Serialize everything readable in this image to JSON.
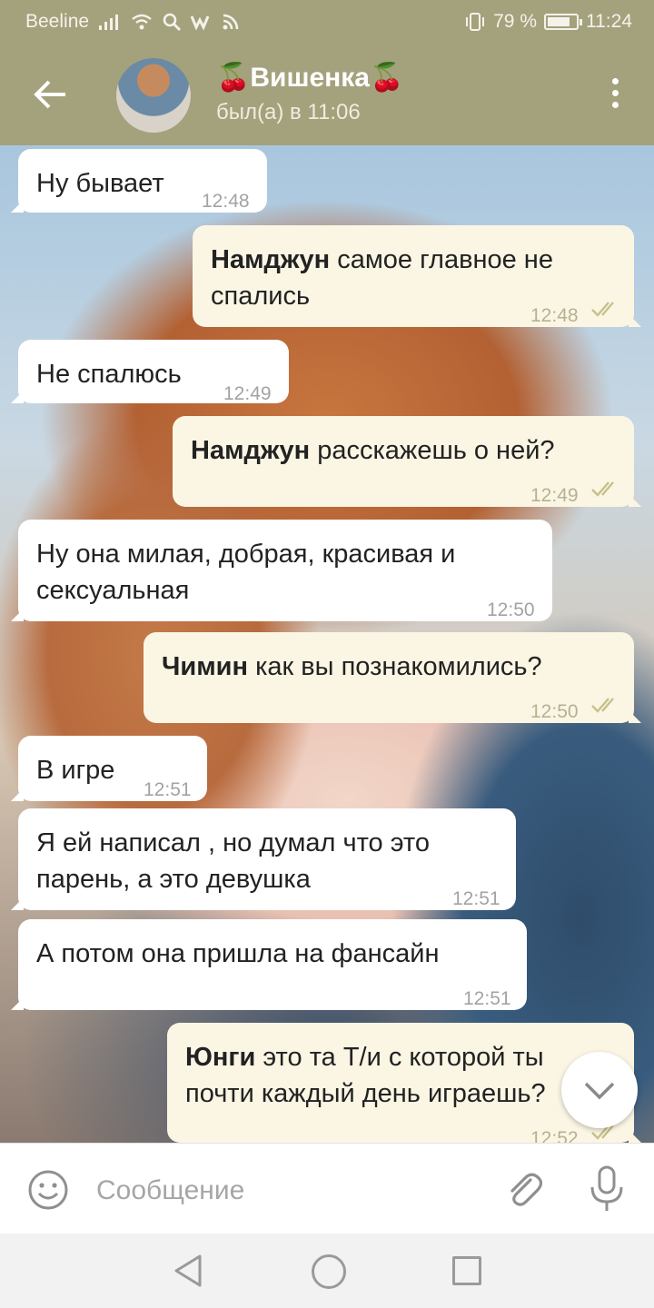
{
  "status_bar": {
    "carrier": "Beeline",
    "battery": "79 %",
    "battery_level": 0.79,
    "time": "11:24",
    "icons": [
      "signal-icon",
      "wifi-icon",
      "search-icon",
      "vk-icon",
      "rss-icon",
      "vibrate-icon",
      "battery-icon"
    ]
  },
  "header": {
    "contact_name": "🍒Вишенка🍒",
    "status": "был(а) в 11:06",
    "icons": [
      "back-arrow-icon",
      "avatar",
      "more-vert-icon"
    ]
  },
  "messages": [
    {
      "dir": "in",
      "text": "Ну бывает",
      "time": "12:48"
    },
    {
      "dir": "out",
      "name": "Намджун",
      "text": "самое главное не спались",
      "line1": "самое главное не",
      "line2": "спались",
      "time": "12:48",
      "read": true
    },
    {
      "dir": "in",
      "text": "Не спалюсь",
      "time": "12:49"
    },
    {
      "dir": "out",
      "name": "Намджун",
      "text": "расскажешь о ней?",
      "time": "12:49",
      "read": true
    },
    {
      "dir": "in",
      "line1": "Ну она милая, добрая, красивая и",
      "line2": "сексуальная",
      "time": "12:50"
    },
    {
      "dir": "out",
      "name": "Чимин",
      "text": "как вы познакомились?",
      "time": "12:50",
      "read": true
    },
    {
      "dir": "in",
      "text": "В игре",
      "time": "12:51"
    },
    {
      "dir": "in",
      "line1": "Я ей написал , но думал что это",
      "line2": "парень, а это девушка",
      "time": "12:51"
    },
    {
      "dir": "in",
      "text": "А потом она пришла на фансайн",
      "time": "12:51"
    },
    {
      "dir": "out",
      "name": "Юнги",
      "line1": "это та Т/и с которой ты",
      "line2": "почти каждый день играешь?",
      "time": "12:52",
      "read": true
    }
  ],
  "input": {
    "placeholder": "Сообщение",
    "icons": [
      "emoji-icon",
      "attach-icon",
      "mic-icon"
    ]
  },
  "scroll_button": {
    "icon": "chevron-down-icon"
  },
  "nav": {
    "icons": [
      "nav-back-icon",
      "nav-home-icon",
      "nav-recents-icon"
    ]
  },
  "colors": {
    "header": "#a4a17d",
    "incoming_bubble": "#ffffff",
    "outgoing_bubble": "#fbf6e4",
    "check_marks": "#c7c08a"
  }
}
